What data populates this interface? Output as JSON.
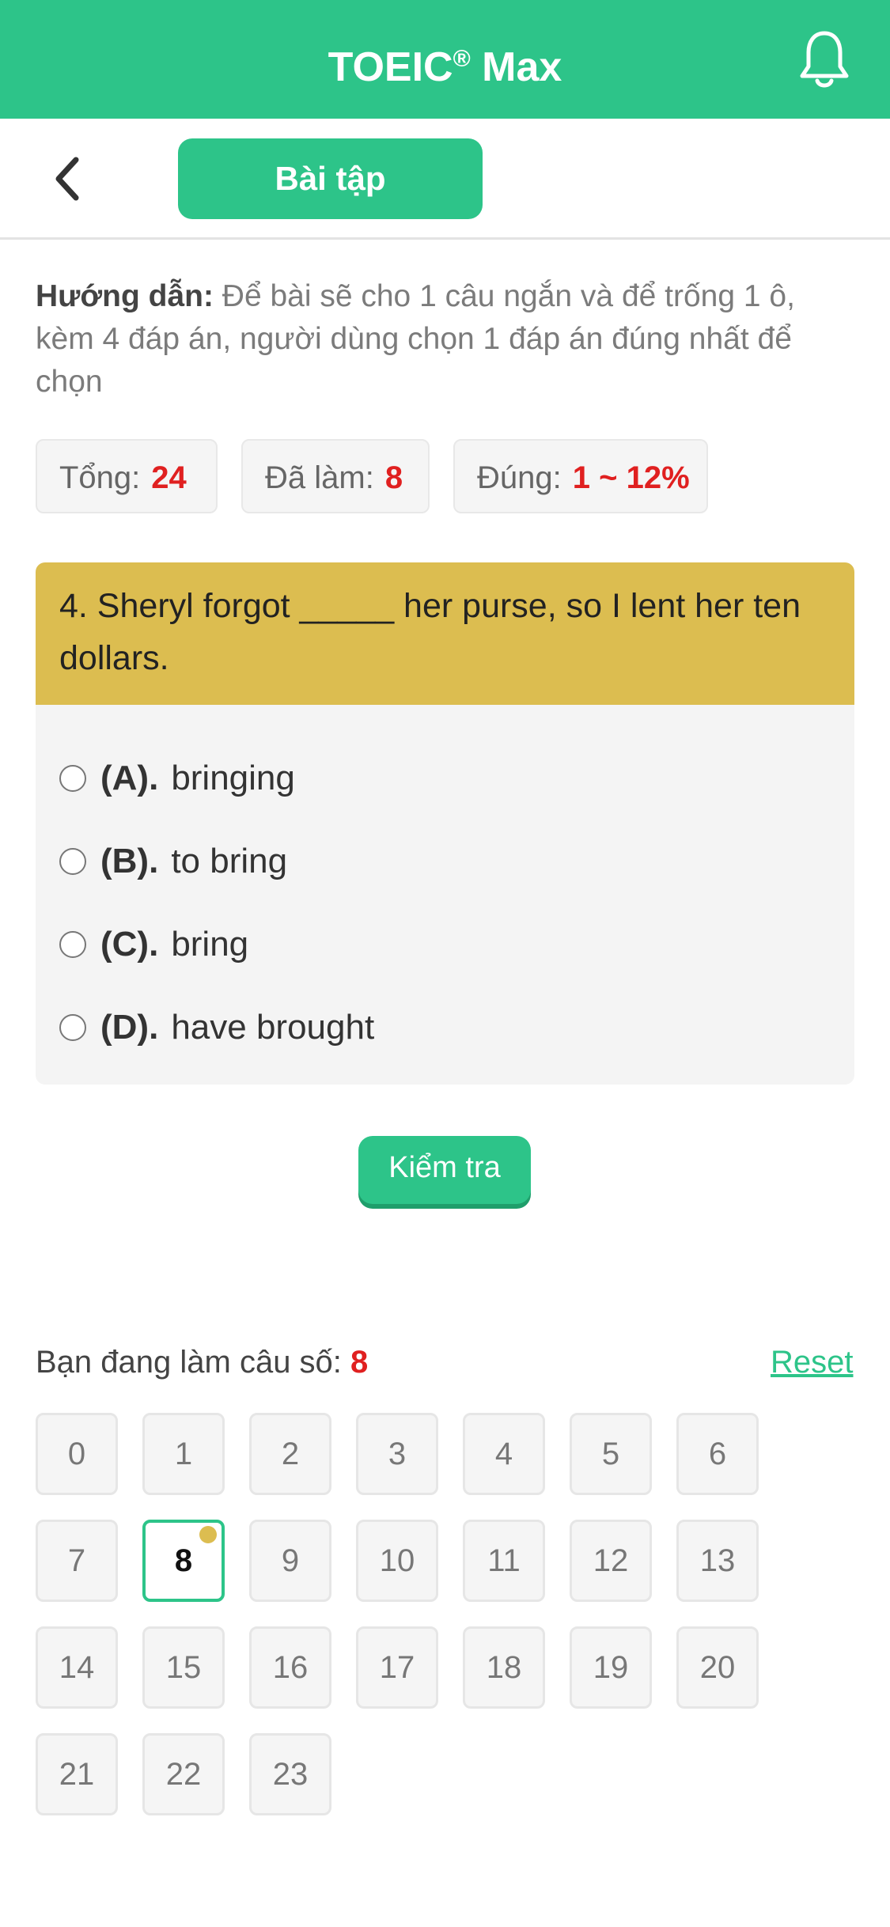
{
  "header": {
    "title": "TOEIC",
    "title_mark": "®",
    "title_suffix": " Max",
    "bell_icon": "bell-icon"
  },
  "subheader": {
    "back_icon": "chevron-left-icon",
    "tab_label": "Bài tập"
  },
  "instructions": {
    "label": "Hướng dẫn:",
    "text": " Để bài sẽ cho 1 câu ngắn và để trống 1 ô, kèm 4 đáp án, người dùng chọn 1 đáp án đúng nhất để chọn"
  },
  "stats": {
    "total_label": "Tổng:",
    "total_value": "24",
    "done_label": "Đã làm:",
    "done_value": "8",
    "correct_label": "Đúng:",
    "correct_value": "1 ~ 12%"
  },
  "question": {
    "text": "4. Sheryl forgot _____ her purse, so I lent her ten dollars.",
    "options": [
      {
        "label": "(A).",
        "text": "bringing"
      },
      {
        "label": "(B).",
        "text": "to bring"
      },
      {
        "label": "(C).",
        "text": "bring"
      },
      {
        "label": "(D).",
        "text": "have brought"
      }
    ]
  },
  "check_button": "Kiểm tra",
  "progress": {
    "current_label": "Bạn đang làm câu số:",
    "current_number": "8",
    "reset_label": "Reset"
  },
  "grid": {
    "numbers": [
      "0",
      "1",
      "2",
      "3",
      "4",
      "5",
      "6",
      "7",
      "8",
      "9",
      "10",
      "11",
      "12",
      "13",
      "14",
      "15",
      "16",
      "17",
      "18",
      "19",
      "20",
      "21",
      "22",
      "23"
    ],
    "active": "8"
  },
  "colors": {
    "accent": "#2dc489",
    "question_header": "#dcbd50",
    "highlight": "#e02020"
  }
}
